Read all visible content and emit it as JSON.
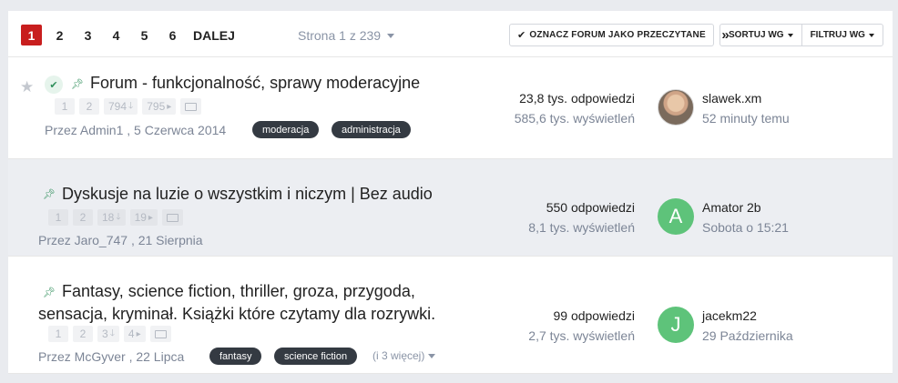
{
  "pagination": {
    "pages": [
      "1",
      "2",
      "3",
      "4",
      "5",
      "6"
    ],
    "next_label": "DALEJ",
    "last_label": "»",
    "page_info": "Strona 1 z 239"
  },
  "actions": {
    "mark_read": "OZNACZ FORUM JAKO PRZECZYTANE",
    "sort": "SORTUJ WG",
    "filter": "FILTRUJ WG"
  },
  "topics": [
    {
      "title": "Forum - funkcjonalność, sprawy moderacyjne",
      "mini_pages": [
        "1",
        "2",
        "794",
        "795"
      ],
      "author": "Przez Admin1 , 5 Czerwca 2014",
      "tags": [
        "moderacja",
        "administracja"
      ],
      "replies": "23,8 tys. odpowiedzi",
      "views": "585,6 tys. wyświetleń",
      "last_user": "slawek.xm",
      "last_time": "52 minuty temu"
    },
    {
      "title": "Dyskusje na luzie o wszystkim i niczym | Bez audio",
      "mini_pages": [
        "1",
        "2",
        "18",
        "19"
      ],
      "author": "Przez Jaro_747 , 21 Sierpnia",
      "replies": "550 odpowiedzi",
      "views": "8,1 tys. wyświetleń",
      "avatar_letter": "A",
      "last_user": "Amator 2b",
      "last_time": "Sobota o 15:21"
    },
    {
      "title_line1": "Fantasy, science fiction, thriller, groza, przygoda,",
      "title_line2": "sensacja, kryminał. Książki które czytamy dla rozrywki.",
      "mini_pages": [
        "1",
        "2",
        "3",
        "4"
      ],
      "author": "Przez McGyver , 22 Lipca",
      "tags": [
        "fantasy",
        "science fiction"
      ],
      "more_tags": "(i 3 więcej)",
      "replies": "99 odpowiedzi",
      "views": "2,7 tys. wyświetleń",
      "avatar_letter": "J",
      "last_user": "jacekm22",
      "last_time": "29 Października"
    }
  ],
  "colors": {
    "active_page": "#c81e1e",
    "pin": "#2f8f5b",
    "tag_bg": "#343a42",
    "avatar_green": "#5ec37a"
  }
}
